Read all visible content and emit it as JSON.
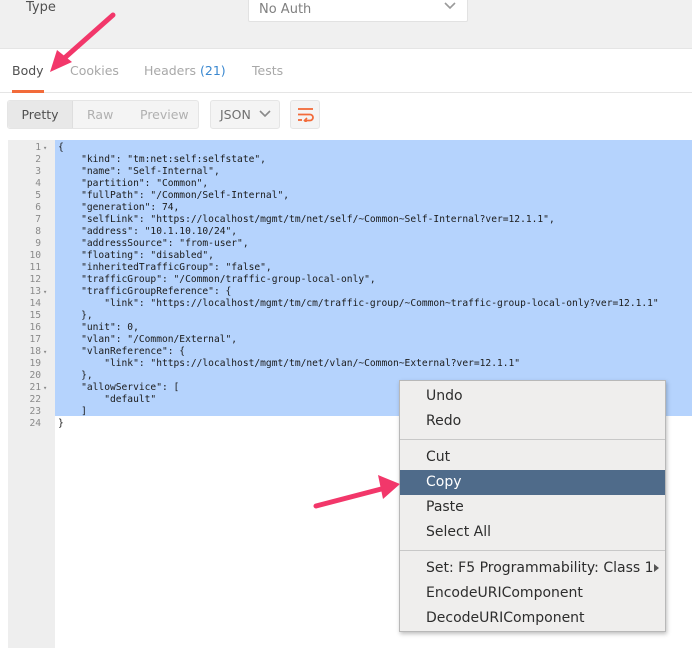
{
  "auth": {
    "type_label": "Type",
    "selected": "No Auth"
  },
  "tabs": [
    {
      "label": "Body",
      "active": true
    },
    {
      "label": "Cookies",
      "active": false
    },
    {
      "label": "Headers",
      "count": "(21)",
      "active": false
    },
    {
      "label": "Tests",
      "active": false
    }
  ],
  "view_modes": [
    "Pretty",
    "Raw",
    "Preview"
  ],
  "format_select": "JSON",
  "wrap_icon": "wrap-lines-icon",
  "code_lines": [
    {
      "n": "1",
      "fold": true,
      "text": "{"
    },
    {
      "n": "2",
      "text": "    \"kind\": \"tm:net:self:selfstate\","
    },
    {
      "n": "3",
      "text": "    \"name\": \"Self-Internal\","
    },
    {
      "n": "4",
      "text": "    \"partition\": \"Common\","
    },
    {
      "n": "5",
      "text": "    \"fullPath\": \"/Common/Self-Internal\","
    },
    {
      "n": "6",
      "text": "    \"generation\": 74,"
    },
    {
      "n": "7",
      "text": "    \"selfLink\": \"https://localhost/mgmt/tm/net/self/~Common~Self-Internal?ver=12.1.1\","
    },
    {
      "n": "8",
      "text": "    \"address\": \"10.1.10.10/24\","
    },
    {
      "n": "9",
      "text": "    \"addressSource\": \"from-user\","
    },
    {
      "n": "10",
      "text": "    \"floating\": \"disabled\","
    },
    {
      "n": "11",
      "text": "    \"inheritedTrafficGroup\": \"false\","
    },
    {
      "n": "12",
      "text": "    \"trafficGroup\": \"/Common/traffic-group-local-only\","
    },
    {
      "n": "13",
      "fold": true,
      "text": "    \"trafficGroupReference\": {"
    },
    {
      "n": "14",
      "text": "        \"link\": \"https://localhost/mgmt/tm/cm/traffic-group/~Common~traffic-group-local-only?ver=12.1.1\""
    },
    {
      "n": "15",
      "text": "    },"
    },
    {
      "n": "16",
      "text": "    \"unit\": 0,"
    },
    {
      "n": "17",
      "text": "    \"vlan\": \"/Common/External\","
    },
    {
      "n": "18",
      "fold": true,
      "text": "    \"vlanReference\": {"
    },
    {
      "n": "19",
      "text": "        \"link\": \"https://localhost/mgmt/tm/net/vlan/~Common~External?ver=12.1.1\""
    },
    {
      "n": "20",
      "text": "    },"
    },
    {
      "n": "21",
      "fold": true,
      "text": "    \"allowService\": ["
    },
    {
      "n": "22",
      "text": "        \"default\""
    },
    {
      "n": "23",
      "text": "    ]"
    },
    {
      "n": "24",
      "text": "}"
    }
  ],
  "context_menu": {
    "items": [
      {
        "label": "Undo"
      },
      {
        "label": "Redo"
      },
      {
        "separator": true
      },
      {
        "label": "Cut"
      },
      {
        "label": "Copy",
        "highlighted": true
      },
      {
        "label": "Paste"
      },
      {
        "label": "Select All"
      },
      {
        "separator": true
      },
      {
        "label": "Set: F5 Programmability: Class 1",
        "submenu": true
      },
      {
        "label": "EncodeURIComponent"
      },
      {
        "label": "DecodeURIComponent"
      }
    ]
  },
  "colors": {
    "accent": "#f26b3a",
    "annotation_arrow": "#f2376a",
    "selection": "#b5d3fd",
    "menu_highlight": "#4f6b8a",
    "link_count": "#3a88d0"
  }
}
